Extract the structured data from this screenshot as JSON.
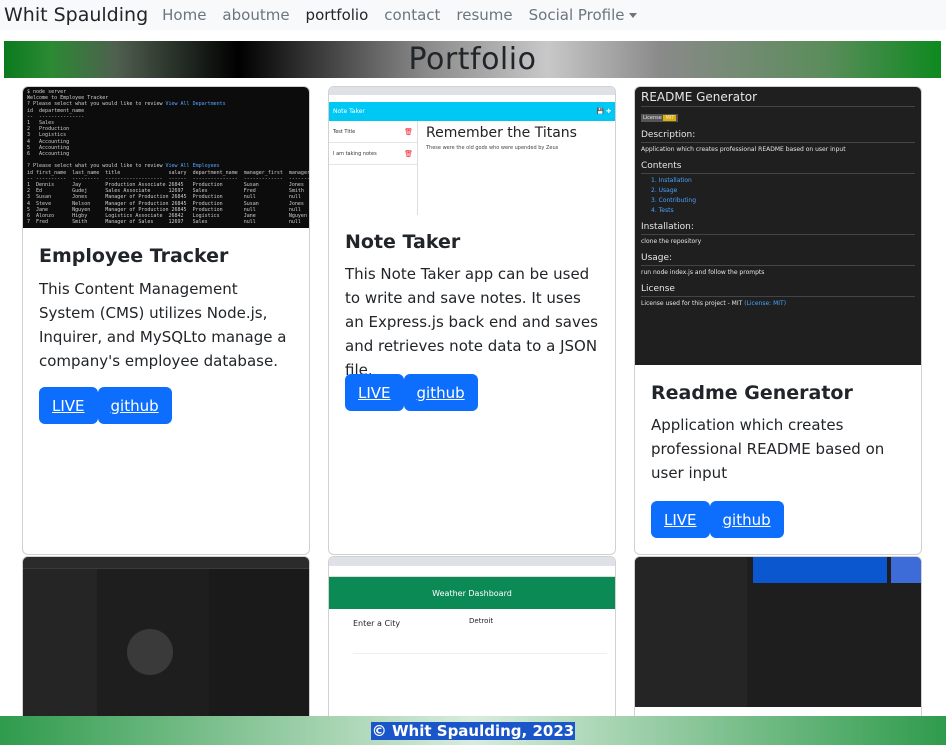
{
  "nav": {
    "brand": "Whit Spaulding",
    "links": [
      "Home",
      "aboutme",
      "portfolio",
      "contact",
      "resume"
    ],
    "dropdown": "Social Profile"
  },
  "banner": {
    "title": "Portfolio"
  },
  "cards": [
    {
      "title": "Employee Tracker",
      "text": "This Content Management System (CMS) utilizes Node.js, Inquirer, and MySQLto manage a company's employee database.",
      "live": "LIVE",
      "github": "github"
    },
    {
      "title": "Note Taker",
      "text": "This Note Taker app can be used to write and save notes. It uses an Express.js back end and saves and retrieves note data to a JSON file.",
      "live": "LIVE",
      "github": "github",
      "screenshot": {
        "header": "Note Taker",
        "notes": [
          "Test Title",
          "I am taking notes"
        ],
        "note_title": "Remember the Titans",
        "note_body": "These were the old gods who were upended by Zeus"
      }
    },
    {
      "title": "Readme Generator",
      "text": "Application which creates professional README based on user input",
      "live": "LIVE",
      "github": "github",
      "screenshot": {
        "title": "README Generator",
        "license_badge": "License",
        "license_value": "MIT",
        "description_h": "Description:",
        "description": "Application which creates professional README based on user input",
        "contents_h": "Contents",
        "contents": [
          "1. Installation",
          "2. Usage",
          "3. Contributing",
          "4. Tests"
        ],
        "installation_h": "Installation:",
        "installation": "clone the repository",
        "usage_h": "Usage:",
        "usage": "run node index.js and follow the prompts",
        "license_h": "License",
        "license_text": "License used for this project - MIT ",
        "license_link": "(License: MIT)"
      }
    }
  ],
  "bottom": {
    "weather_header": "Weather Dashboard",
    "weather_city_label": "Enter a City",
    "weather_city": "Detroit"
  },
  "footer": {
    "text": "© Whit Spaulding, 2023"
  },
  "colors": {
    "button": "#0d6efd",
    "banner_green": "#0b7a1f",
    "footer_highlight": "#1a56c9"
  }
}
